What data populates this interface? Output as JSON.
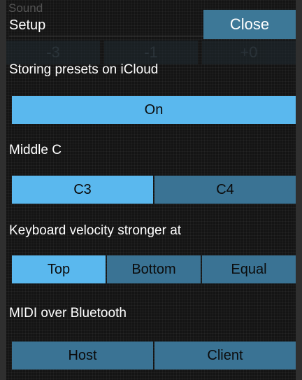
{
  "ghost": {
    "label": "Sound",
    "transpose": [
      "-3",
      "-1",
      "+0"
    ]
  },
  "header": {
    "title": "Setup",
    "close_label": "Close"
  },
  "icloud": {
    "label": "Storing presets on iCloud",
    "options": [
      {
        "label": "On",
        "selected": true
      }
    ]
  },
  "middle_c": {
    "label": "Middle C",
    "options": [
      {
        "label": "C3",
        "selected": true
      },
      {
        "label": "C4",
        "selected": false
      }
    ]
  },
  "velocity": {
    "label": "Keyboard velocity stronger at",
    "options": [
      {
        "label": "Top",
        "selected": true
      },
      {
        "label": "Bottom",
        "selected": false
      },
      {
        "label": "Equal",
        "selected": false
      }
    ]
  },
  "bluetooth": {
    "label": "MIDI over Bluetooth",
    "options": [
      {
        "label": "Host",
        "selected": false
      },
      {
        "label": "Client",
        "selected": false
      }
    ]
  },
  "colors": {
    "background": "#141414",
    "selected": "#5ab8ee",
    "unselected": "#3a7394",
    "close_button": "#3d7897"
  }
}
